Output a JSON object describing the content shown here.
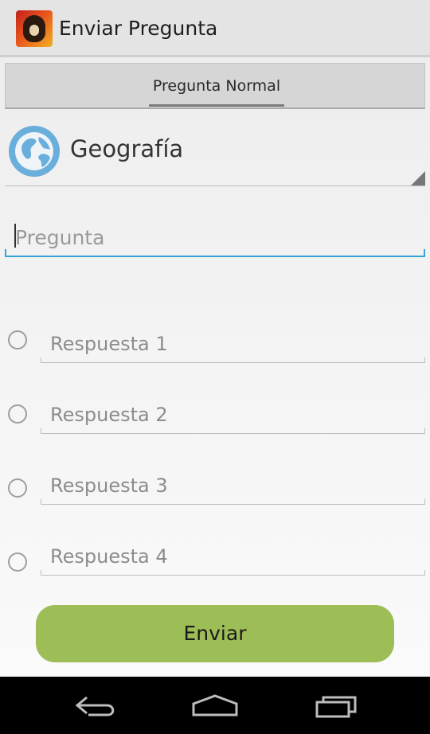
{
  "action_bar": {
    "title": "Enviar Pregunta",
    "app_icon": "app-logo-icon"
  },
  "tabs": [
    {
      "label": "Pregunta Normal",
      "selected": true
    }
  ],
  "category_spinner": {
    "selected": "Geografía",
    "icon": "globe-icon"
  },
  "question_field": {
    "value": "",
    "placeholder": "Pregunta"
  },
  "answers": [
    {
      "placeholder": "Respuesta 1",
      "value": "",
      "checked": false
    },
    {
      "placeholder": "Respuesta 2",
      "value": "",
      "checked": false
    },
    {
      "placeholder": "Respuesta 3",
      "value": "",
      "checked": false
    },
    {
      "placeholder": "Respuesta 4",
      "value": "",
      "checked": false
    }
  ],
  "send_button": {
    "label": "Enviar"
  },
  "nav_bar": {
    "back_icon": "back-icon",
    "home_icon": "home-icon",
    "recents_icon": "recent-apps-icon"
  },
  "colors": {
    "accent_blue": "#33a5d6",
    "send_button_green": "#9dbe57",
    "globe_blue": "#6aaedc"
  }
}
